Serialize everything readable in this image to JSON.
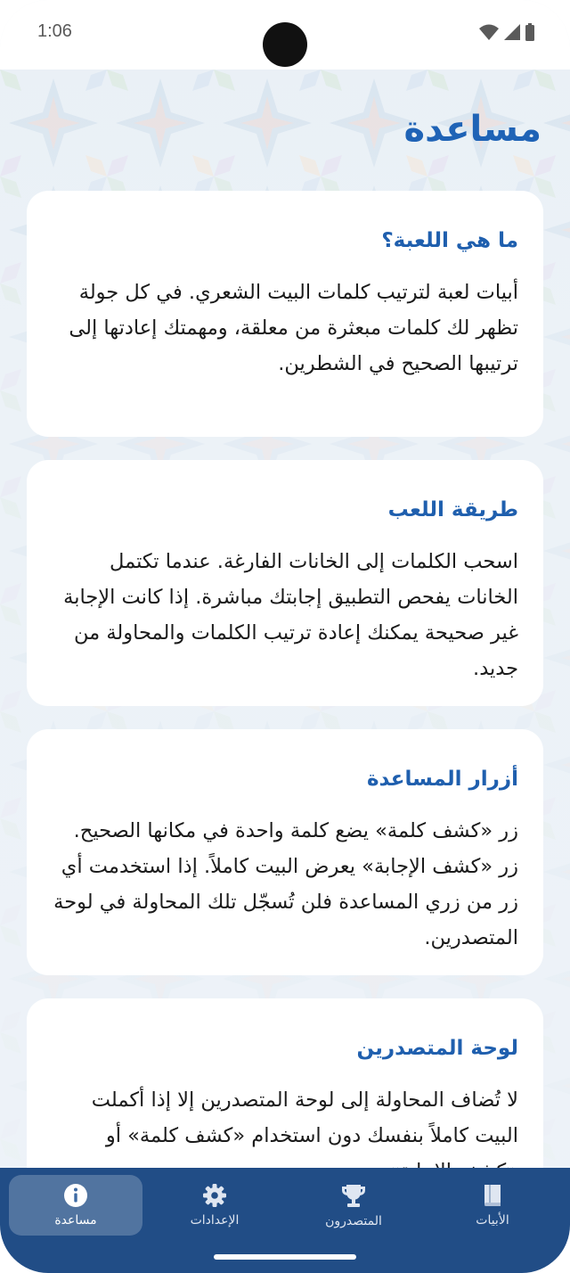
{
  "status": {
    "time": "1:06"
  },
  "page": {
    "title": "مساعدة"
  },
  "cards": [
    {
      "title": "ما هي اللعبة؟",
      "body": "أبيات لعبة لترتيب كلمات البيت الشعري. في كل جولة تظهر لك كلمات مبعثرة من معلقة، ومهمتك إعادتها إلى ترتيبها الصحيح في الشطرين."
    },
    {
      "title": "طريقة اللعب",
      "body": "اسحب الكلمات إلى الخانات الفارغة. عندما تكتمل الخانات يفحص التطبيق إجابتك مباشرة. إذا كانت الإجابة غير صحيحة يمكنك إعادة ترتيب الكلمات والمحاولة من جديد."
    },
    {
      "title": "أزرار المساعدة",
      "body": "زر «كشف كلمة» يضع كلمة واحدة في مكانها الصحيح. زر «كشف الإجابة» يعرض البيت كاملاً. إذا استخدمت أي زر من زري المساعدة فلن تُسجّل تلك المحاولة في لوحة المتصدرين."
    },
    {
      "title": "لوحة المتصدرين",
      "body": "لا تُضاف المحاولة إلى لوحة المتصدرين إلا إذا أكملت البيت كاملاً بنفسك دون استخدام «كشف كلمة» أو «كشف الإجابة»"
    }
  ],
  "nav": {
    "items": [
      {
        "label": "مساعدة",
        "icon": "info-icon",
        "active": true
      },
      {
        "label": "الإعدادات",
        "icon": "gear-icon",
        "active": false
      },
      {
        "label": "المتصدرون",
        "icon": "trophy-icon",
        "active": false
      },
      {
        "label": "الأبيات",
        "icon": "book-icon",
        "active": false
      }
    ]
  },
  "colors": {
    "accent": "#1f63b6",
    "nav_bg": "#214d86",
    "card_bg": "#ffffff",
    "page_bg": "#eef3f8"
  }
}
